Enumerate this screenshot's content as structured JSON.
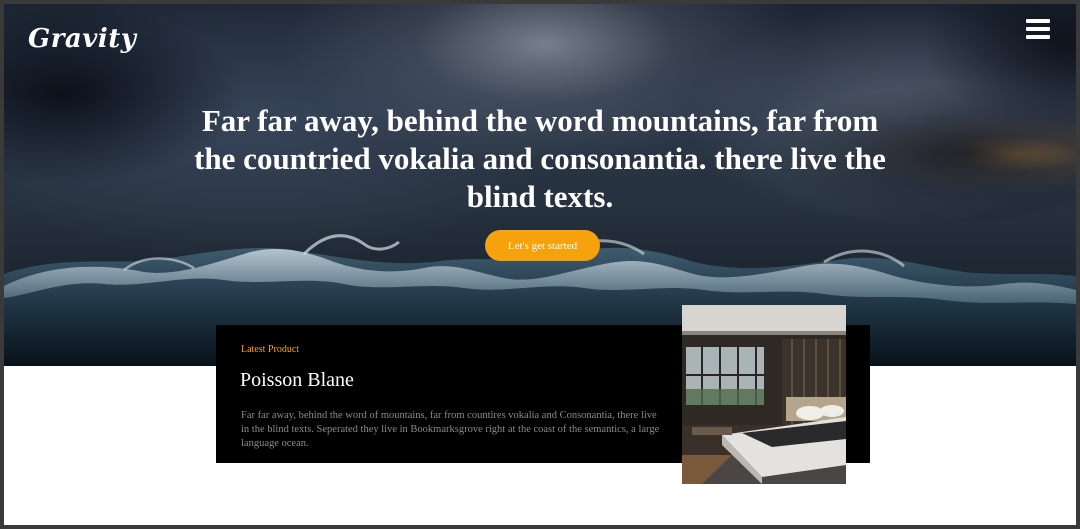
{
  "brand": {
    "logo_text": "Gravity"
  },
  "header": {
    "menu_icon": "hamburger-menu-icon"
  },
  "hero": {
    "headline": "Far far away, behind the word mountains, far from the countried vokalia and consonantia. there live the blind texts.",
    "cta_label": "Let's get started",
    "background": "stormy-sea-image"
  },
  "product": {
    "eyebrow": "Latest Product",
    "title": "Poisson Blane",
    "description": "Far far away, behind the word of mountains, far from countires vokalia and Consonantia, there live in the blind texts. Seperated they live in Bookmarksgrove right at the coast of the semantics, a large language ocean.",
    "image": "bedroom-interior-image"
  },
  "colors": {
    "accent": "#f5a20c",
    "card_bg": "#000000",
    "page_bg": "#ffffff",
    "body_text": "#8a8a8a"
  }
}
